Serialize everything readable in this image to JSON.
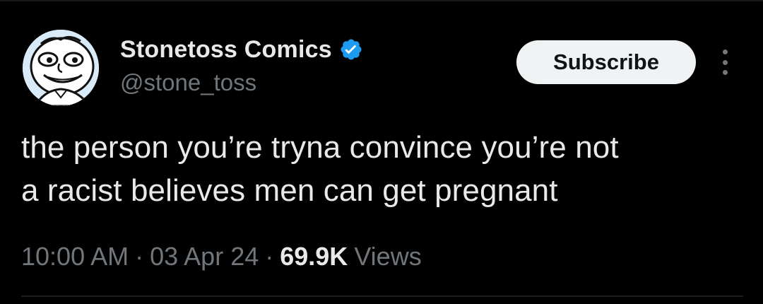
{
  "author": {
    "display_name": "Stonetoss Comics",
    "handle": "@stone_toss",
    "verified": true,
    "avatar_icon": "cartoon-face-avatar"
  },
  "actions": {
    "subscribe_label": "Subscribe",
    "more_icon": "more-vertical-icon"
  },
  "tweet": {
    "text": "the person you’re tryna convince you’re not\na racist believes men can get pregnant"
  },
  "meta": {
    "time": "10:00 AM",
    "separator": "·",
    "date": "03 Apr 24",
    "views_count": "69.9K",
    "views_label": "Views"
  },
  "colors": {
    "background": "#000000",
    "primary_text": "#e7e9ea",
    "secondary_text": "#71767b",
    "verified_blue": "#1d9bf0",
    "button_bg": "#eff3f4"
  }
}
